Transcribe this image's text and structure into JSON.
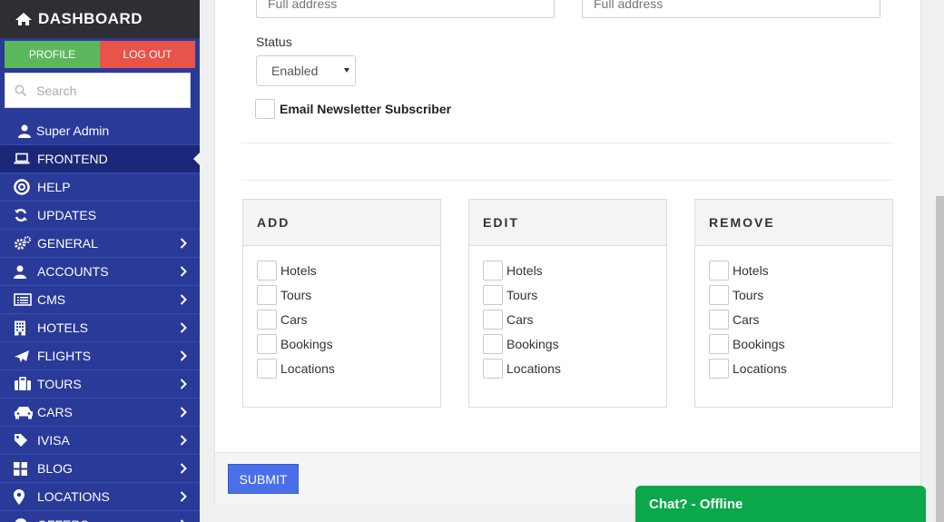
{
  "sidebar": {
    "brand": "DASHBOARD",
    "profile_label": "PROFILE",
    "logout_label": "LOG OUT",
    "search_placeholder": "Search",
    "user": "Super Admin",
    "items": [
      {
        "label": "FRONTEND",
        "icon": "laptop-icon",
        "chevron": false,
        "active": true
      },
      {
        "label": "HELP",
        "icon": "lifebuoy-icon",
        "chevron": false
      },
      {
        "label": "UPDATES",
        "icon": "refresh-icon",
        "chevron": false
      },
      {
        "label": "GENERAL",
        "icon": "cogs-icon",
        "chevron": true
      },
      {
        "label": "ACCOUNTS",
        "icon": "user-icon",
        "chevron": true
      },
      {
        "label": "CMS",
        "icon": "list-alt-icon",
        "chevron": true
      },
      {
        "label": "HOTELS",
        "icon": "building-icon",
        "chevron": true
      },
      {
        "label": "FLIGHTS",
        "icon": "plane-icon",
        "chevron": true
      },
      {
        "label": "TOURS",
        "icon": "suitcase-icon",
        "chevron": true
      },
      {
        "label": "CARS",
        "icon": "car-icon",
        "chevron": true
      },
      {
        "label": "IVISA",
        "icon": "tag-icon",
        "chevron": true
      },
      {
        "label": "BLOG",
        "icon": "grid-icon",
        "chevron": true
      },
      {
        "label": "LOCATIONS",
        "icon": "map-marker-icon",
        "chevron": true
      },
      {
        "label": "OFFERS",
        "icon": "offers-icon",
        "chevron": true
      }
    ],
    "colors": {
      "bg": "#2a3a99",
      "active": "#1b2778",
      "profile": "#5cb85c",
      "logout": "#e8534a"
    }
  },
  "form": {
    "address_placeholder_1": "Full address",
    "address_placeholder_2": "Full address",
    "status_label": "Status",
    "status_value": "Enabled",
    "newsletter_label": "Email Newsletter Subscriber"
  },
  "permissions": {
    "add": {
      "title": "ADD",
      "items": [
        "Hotels",
        "Tours",
        "Cars",
        "Bookings",
        "Locations"
      ]
    },
    "edit": {
      "title": "EDIT",
      "items": [
        "Hotels",
        "Tours",
        "Cars",
        "Bookings",
        "Locations"
      ]
    },
    "remove": {
      "title": "REMOVE",
      "items": [
        "Hotels",
        "Tours",
        "Cars",
        "Bookings",
        "Locations"
      ]
    }
  },
  "submit_label": "SUBMIT",
  "chat_label": "Chat? - Offline",
  "colors": {
    "submit": "#4a6fe8",
    "chat": "#0aa84b"
  }
}
